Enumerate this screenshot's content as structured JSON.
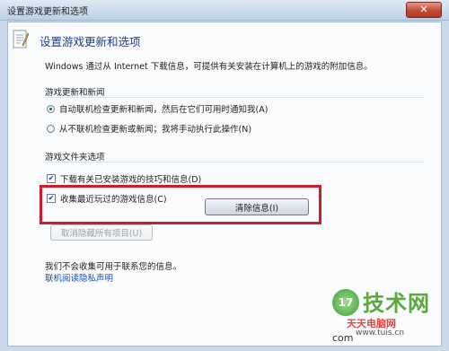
{
  "window": {
    "title": "设置游戏更新和选项",
    "close_glyph": "✕"
  },
  "header": {
    "title": "设置游戏更新和选项"
  },
  "description": "Windows 通过从 Internet 下载信息，可提供有关安装在计算机上的游戏的附加信息。",
  "updates_group": {
    "label": "游戏更新和新闻",
    "options": [
      {
        "label": "自动联机检查更新和新闻，然后在它们可用时通知我(A)",
        "selected": true
      },
      {
        "label": "从不联机检查更新或新闻；我将手动执行此操作(N)",
        "selected": false
      }
    ]
  },
  "folder_group": {
    "label": "游戏文件夹选项",
    "checkboxes": [
      {
        "label": "下载有关已安装游戏的技巧和信息(D)",
        "checked": true
      },
      {
        "label": "收集最近玩过的游戏信息(C)",
        "checked": true
      }
    ],
    "clear_button": "清除信息(I)",
    "unhide_button": "取消隐藏所有项目(U)"
  },
  "footer": {
    "note": "我们不会收集可用于联系您的信息。",
    "privacy_link": "联机阅读隐私声明"
  },
  "watermark": {
    "badge": "17",
    "brand": "技术网",
    "sub": "天天电脑网",
    "url": "www.tuis.cn",
    "url2": "com"
  },
  "colors": {
    "accent": "#1c3f8a",
    "highlight": "#d11b2a",
    "link": "#1650b8"
  }
}
